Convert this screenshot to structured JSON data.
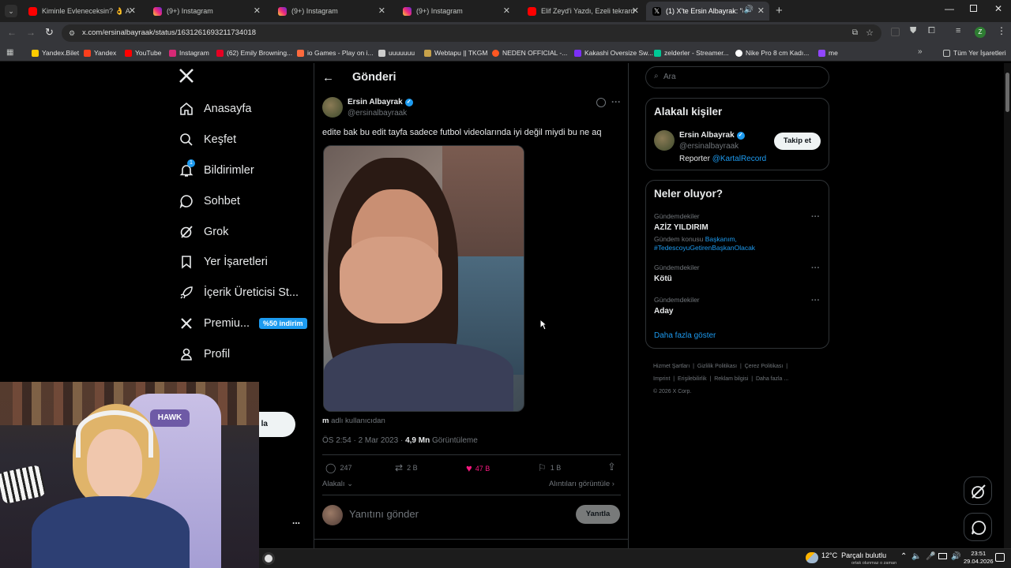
{
  "tabs": [
    {
      "title": "Kiminle Evleneceksin? 👌 Adı, B",
      "favicon": "youtube",
      "color": "#ff0000"
    },
    {
      "title": "(9+) Instagram",
      "favicon": "instagram",
      "color": "#d62976"
    },
    {
      "title": "(9+) Instagram",
      "favicon": "instagram",
      "color": "#d62976"
    },
    {
      "title": "(9+) Instagram",
      "favicon": "instagram",
      "color": "#d62976"
    },
    {
      "title": "Elif Zeyd'i Yazdı, Ezeli tekrardan",
      "favicon": "youtube",
      "color": "#ff0000"
    },
    {
      "title": "(1) X'te Ersin Albayrak: \"edi",
      "favicon": "x",
      "color": "#ffffff"
    }
  ],
  "url": "x.com/ersinalbayraak/status/1631261693211734018",
  "bookmarks": [
    {
      "label": "Yandex.Bilet",
      "color": "#ffcc00"
    },
    {
      "label": "Yandex",
      "color": "#fc3f1d"
    },
    {
      "label": "YouTube",
      "color": "#ff0000"
    },
    {
      "label": "Instagram",
      "color": "#d62976"
    },
    {
      "label": "(62) Emily Browning...",
      "color": "#e60023"
    },
    {
      "label": "io Games - Play on i...",
      "color": "#ff6a3d"
    },
    {
      "label": "uuuuuuu",
      "color": "#cccccc"
    },
    {
      "label": "Webtapu || TKGM",
      "color": "#c8a24a"
    },
    {
      "label": "NEDEN OFFICIAL -...",
      "color": "#ff5722"
    },
    {
      "label": "Kakashi Oversize Sw...",
      "color": "#7b2ff7"
    },
    {
      "label": "zelderler - Streamer...",
      "color": "#00c896"
    },
    {
      "label": "Nike Pro 8 cm Kadı...",
      "color": "#ffffff"
    },
    {
      "label": "me",
      "color": "#9146ff"
    }
  ],
  "all_bookmarks": "Tüm Yer İşaretleri",
  "nav": {
    "items": [
      "Anasayfa",
      "Keşfet",
      "Bildirimler",
      "Sohbet",
      "Grok",
      "Yer İşaretleri",
      "İçerik Üreticisi St...",
      "Premiu...",
      "Profil"
    ],
    "premium_badge": "%50 indirim",
    "notification_count": "1",
    "post_button_fragment": "la",
    "more": "..."
  },
  "post": {
    "header_title": "Gönderi",
    "author_name": "Ersin Albayrak",
    "author_handle": "@ersinalbayraak",
    "text": "edite bak bu edit tayfa sadece futbol videolarında iyi değil miydi bu ne aq",
    "source_user": "m",
    "source_suffix": "adlı kullanıcıdan",
    "time": "ÖS 2:54 · 2 Mar 2023 ·",
    "views_count": "4,9 Mn",
    "views_label": "Görüntüleme",
    "replies": "247",
    "reposts": "2 B",
    "likes": "47 B",
    "bookmarks": "1 B",
    "related": "Alakalı",
    "quotes": "Alıntıları görüntüle",
    "reply_placeholder": "Yanıtını gönder",
    "reply_button": "Yanıtla"
  },
  "search": {
    "placeholder": "Ara"
  },
  "related_people": {
    "title": "Alakalı kişiler",
    "name": "Ersin Albayrak",
    "handle": "@ersinalbayraak",
    "bio_prefix": "Reporter",
    "bio_link": "@KartalRecord",
    "follow": "Takip et"
  },
  "trends": {
    "title": "Neler oluyor?",
    "items": [
      {
        "category": "Gündemdekiler",
        "name": "AZİZ YILDIRIM",
        "topic_prefix": "Gündem konusu",
        "topic_link": "Başkanım,",
        "topic_line2": "#TedescoyuGetirenBaşkanOlacak"
      },
      {
        "category": "Gündemdekiler",
        "name": "Kötü"
      },
      {
        "category": "Gündemdekiler",
        "name": "Aday"
      }
    ],
    "show_more": "Daha fazla göster"
  },
  "footer": {
    "links": [
      "Hizmet Şartları",
      "Gizlilik Politikası",
      "Çerez Politikası",
      "Imprint",
      "Erişilebilirlik",
      "Reklam bilgisi",
      "Daha fazla ..."
    ],
    "copyright": "© 2026 X Corp."
  },
  "webcam": {
    "cap_text": "HAWK"
  },
  "taskbar": {
    "weather_temp": "12°C",
    "weather_text": "Parçalı bulutlu",
    "weather_sub": "ortak olunmaz o zaman",
    "time": "23:51",
    "date": "29.04.2026"
  },
  "colors": {
    "accent": "#1d9bf0",
    "like": "#f91880",
    "premium_badge": "#1d9bf0"
  }
}
